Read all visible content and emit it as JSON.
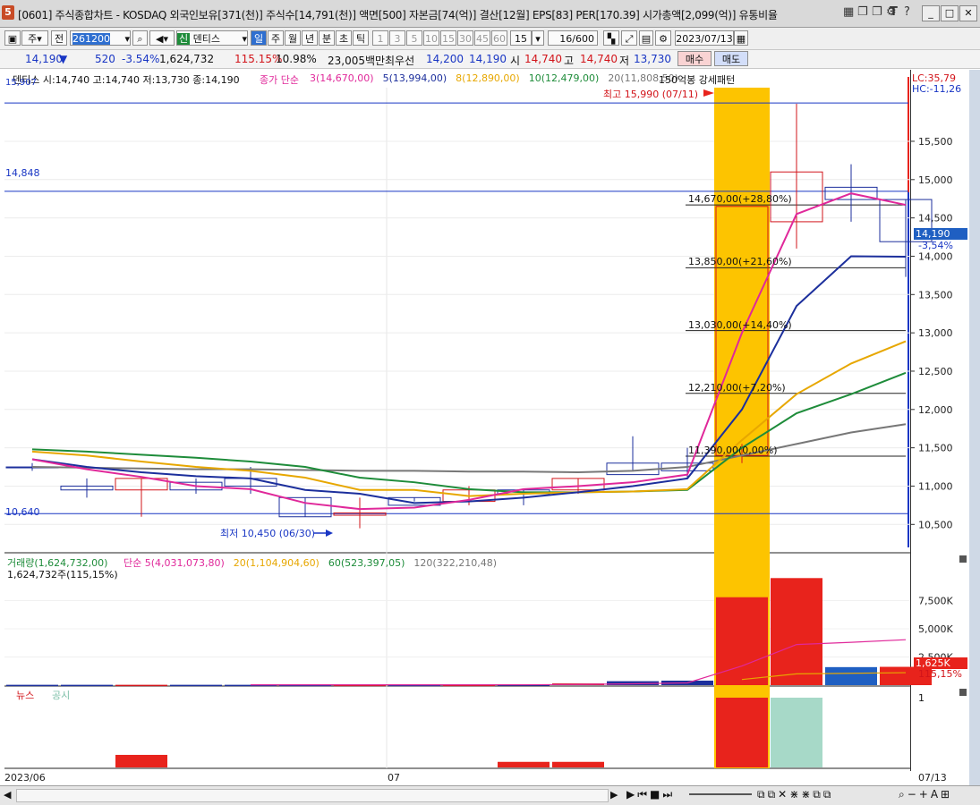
{
  "window": {
    "app_number": "5",
    "title": "[0601] 주식종합차트 - KOSDAQ 외국인보유[371(천)] 주식수[14,791(천)] 액면[500] 자본금[74(억)] 결산[12월] EPS[83] PER[170.39] 시가총액[2,099(억)] 유통비율",
    "icons": [
      "grid-icon",
      "window-icon",
      "window-icon",
      "gear-icon",
      "font-icon",
      "help-icon",
      "minimize-icon",
      "maximize-icon",
      "close-icon"
    ],
    "icon_glyphs": [
      "▦",
      "❐",
      "❐",
      "⚙",
      "T",
      "?",
      "_",
      "□",
      "✕"
    ]
  },
  "toolbar": {
    "type_select": "주",
    "prev_label": "전",
    "code": "261200",
    "stock_badge": "신",
    "stock_name": "덴티스",
    "periods": [
      "일",
      "주",
      "월",
      "년",
      "분",
      "초",
      "틱"
    ],
    "active_period": "일",
    "intervals": [
      "1",
      "3",
      "5",
      "10",
      "15",
      "30",
      "45",
      "60"
    ],
    "interval_value": "15",
    "count": "16/600",
    "date": "2023/07/13"
  },
  "quote": {
    "price": "14,190",
    "direction": "▼",
    "change": "520",
    "change_pct": "-3.54%",
    "volume": "1,624,732",
    "volume_ratio": "115.15%",
    "turnover": "10.98%",
    "amount": "23,005백만",
    "best_bid_label": "최우선",
    "best_ask": "14,200",
    "best_bid": "14,190",
    "open_label": "시",
    "open": "14,740",
    "high_label": "고",
    "high": "14,740",
    "low_label": "저",
    "low": "13,730",
    "buy_label": "매수",
    "sell_label": "매도"
  },
  "legend": {
    "ohlc": "덴티스 시:14,740 고:14,740 저:13,730 종:14,190",
    "ma_prefix": "종가 단순",
    "ma_items": [
      {
        "text": "3(14,670,00)",
        "color": "#e0289a"
      },
      {
        "text": "5(13,994,00)",
        "color": "#1c2f9c"
      },
      {
        "text": "8(12,890,00)",
        "color": "#e7a700"
      },
      {
        "text": "10(12,479,00)",
        "color": "#1e8c3a"
      },
      {
        "text": "20(11,808,50)",
        "color": "#777777"
      }
    ],
    "pattern_label": "150억봉 강세패턴",
    "lc": "LC:35,79",
    "hc": "HC:-11,26"
  },
  "annotations": {
    "high_marker": "최고 15,990 (07/11)",
    "low_marker": "최저 10,450 (06/30)",
    "hline_upper": "14,848",
    "hline_lower": "10,640",
    "top_left_value": "15,907",
    "fib": [
      {
        "price": 14670,
        "label": "14,670,00(+28,80%)"
      },
      {
        "price": 13850,
        "label": "13,850,00(+21,60%)"
      },
      {
        "price": 13030,
        "label": "13,030,00(+14,40%)"
      },
      {
        "price": 12210,
        "label": "12,210,00(+7,20%)"
      },
      {
        "price": 11390,
        "label": "11,390,00(0,00%)"
      }
    ],
    "current_price_tag": "14,190",
    "current_pct_tag": "-3,54%",
    "volume_tag": "1,625K",
    "volume_pct_tag": "115,15%"
  },
  "chart_data": {
    "type": "candlestick",
    "price_axis": {
      "min": 10200,
      "max": 16200,
      "ticks": [
        10500,
        11000,
        11500,
        12000,
        12500,
        13000,
        13500,
        14000,
        14500,
        15000,
        15500
      ],
      "tick_labels": [
        "10,500",
        "11,000",
        "11,500",
        "12,000",
        "12,500",
        "13,000",
        "13,500",
        "14,000",
        "14,500",
        "15,000",
        "15,500"
      ]
    },
    "candles": [
      {
        "o": 11250,
        "h": 11300,
        "l": 11200,
        "c": 11250,
        "color": "#1c2f9c",
        "filled": false
      },
      {
        "o": 11000,
        "h": 11100,
        "l": 10850,
        "c": 10950,
        "color": "#1c2f9c",
        "filled": false
      },
      {
        "o": 10950,
        "h": 11100,
        "l": 10600,
        "c": 11100,
        "color": "#d2141a",
        "filled": false
      },
      {
        "o": 11050,
        "h": 11100,
        "l": 10900,
        "c": 10950,
        "color": "#1c2f9c",
        "filled": false
      },
      {
        "o": 11100,
        "h": 11250,
        "l": 10900,
        "c": 11000,
        "color": "#1c2f9c",
        "filled": false
      },
      {
        "o": 10850,
        "h": 10850,
        "l": 10600,
        "c": 10600,
        "color": "#1c2f9c",
        "filled": false
      },
      {
        "o": 10620,
        "h": 10850,
        "l": 10450,
        "c": 10650,
        "color": "#d2141a",
        "filled": false
      },
      {
        "o": 10850,
        "h": 10850,
        "l": 10800,
        "c": 10750,
        "color": "#1c2f9c",
        "filled": false
      },
      {
        "o": 10800,
        "h": 11000,
        "l": 10750,
        "c": 10950,
        "color": "#d2141a",
        "filled": false
      },
      {
        "o": 10950,
        "h": 10950,
        "l": 10750,
        "c": 10900,
        "color": "#1c2f9c",
        "filled": false
      },
      {
        "o": 10950,
        "h": 11100,
        "l": 10900,
        "c": 11100,
        "color": "#d2141a",
        "filled": false
      },
      {
        "o": 11300,
        "h": 11650,
        "l": 11200,
        "c": 11150,
        "color": "#1c2f9c",
        "filled": false
      },
      {
        "o": 11300,
        "h": 11500,
        "l": 11100,
        "c": 11200,
        "color": "#1c2f9c",
        "filled": false
      },
      {
        "o": 11400,
        "h": 11550,
        "l": 11300,
        "c": 14650,
        "color": "#d2141a",
        "filled": false
      },
      {
        "o": 14450,
        "h": 15990,
        "l": 14100,
        "c": 15100,
        "color": "#d2141a",
        "filled": false
      },
      {
        "o": 14900,
        "h": 15200,
        "l": 14450,
        "c": 14740,
        "color": "#1c2f9c",
        "filled": false
      },
      {
        "o": 14740,
        "h": 14740,
        "l": 13730,
        "c": 14190,
        "color": "#1c2f9c",
        "filled": false
      }
    ],
    "ma3": [
      11350,
      11220,
      11120,
      11000,
      10960,
      10780,
      10700,
      10720,
      10820,
      10960,
      11000,
      11050,
      11150,
      13000,
      14550,
      14820,
      14670
    ],
    "ma5": [
      11350,
      11250,
      11180,
      11130,
      11100,
      10950,
      10900,
      10780,
      10800,
      10850,
      10920,
      11000,
      11100,
      12000,
      13350,
      14000,
      13994
    ],
    "ma8": [
      11450,
      11400,
      11320,
      11250,
      11200,
      11110,
      10950,
      10950,
      10870,
      10900,
      10920,
      10930,
      10960,
      11600,
      12200,
      12600,
      12890
    ],
    "ma10": [
      11480,
      11450,
      11410,
      11370,
      11320,
      11250,
      11110,
      11050,
      10960,
      10920,
      10920,
      10930,
      10950,
      11500,
      11950,
      12200,
      12479
    ],
    "ma20": [
      11250,
      11240,
      11230,
      11220,
      11220,
      11210,
      11200,
      11200,
      11190,
      11190,
      11180,
      11200,
      11250,
      11400,
      11550,
      11700,
      11808
    ],
    "volume_axis": {
      "max": 10000,
      "ticks": [
        2500,
        5000,
        7500
      ],
      "tick_labels": [
        "2,500K",
        "5,000K",
        "7,500K"
      ]
    },
    "volume": [
      30,
      30,
      30,
      30,
      30,
      30,
      30,
      30,
      30,
      50,
      150,
      350,
      400,
      7800,
      9500,
      1600,
      1625
    ],
    "volume_colors": [
      "#1c2f9c",
      "#1c2f9c",
      "#d2141a",
      "#1c2f9c",
      "#1c2f9c",
      "#1c2f9c",
      "#d2141a",
      "#1c2f9c",
      "#d2141a",
      "#1c2f9c",
      "#d2141a",
      "#1c2f9c",
      "#1c2f9c",
      "#e8231c",
      "#e8231c",
      "#1f5fc2",
      "#e8231c"
    ],
    "volume_ma5": [
      null,
      null,
      null,
      null,
      30,
      30,
      30,
      30,
      30,
      35,
      60,
      120,
      200,
      1700,
      3600,
      3800,
      4031
    ],
    "volume_ma20": [
      null,
      null,
      null,
      null,
      null,
      null,
      null,
      null,
      null,
      null,
      null,
      null,
      null,
      500,
      1000,
      1050,
      1105
    ],
    "news": [
      0,
      0,
      0.18,
      0,
      0,
      0,
      0,
      0,
      0,
      0.08,
      0.08,
      0,
      0,
      1,
      1,
      0,
      0
    ],
    "news_colors": [
      "#e8231c",
      "#e8231c",
      "#e8231c",
      "#e8231c",
      "#e8231c",
      "#e8231c",
      "#e8231c",
      "#e8231c",
      "#e8231c",
      "#e8231c",
      "#e8231c",
      "#e8231c",
      "#e8231c",
      "#e8231c",
      "#a7d9c8",
      "#e8231c",
      "#e8231c"
    ],
    "date_labels": [
      "2023/06",
      "07",
      "07/13"
    ],
    "highlight_index": 13
  },
  "volume_legend": {
    "label": "거래량(1,624,732,00)",
    "items": [
      {
        "text": "단순 5(4,031,073,80)",
        "color": "#e0289a"
      },
      {
        "text": "20(1,104,904,60)",
        "color": "#e7a700"
      },
      {
        "text": "60(523,397,05)",
        "color": "#1e8c3a"
      },
      {
        "text": "120(322,210,48)",
        "color": "#777777"
      }
    ],
    "subtext": "1,624,732주(115,15%)"
  },
  "news_legend": {
    "news": "뉴스",
    "disclosure": "공시",
    "axis_one": "1"
  }
}
